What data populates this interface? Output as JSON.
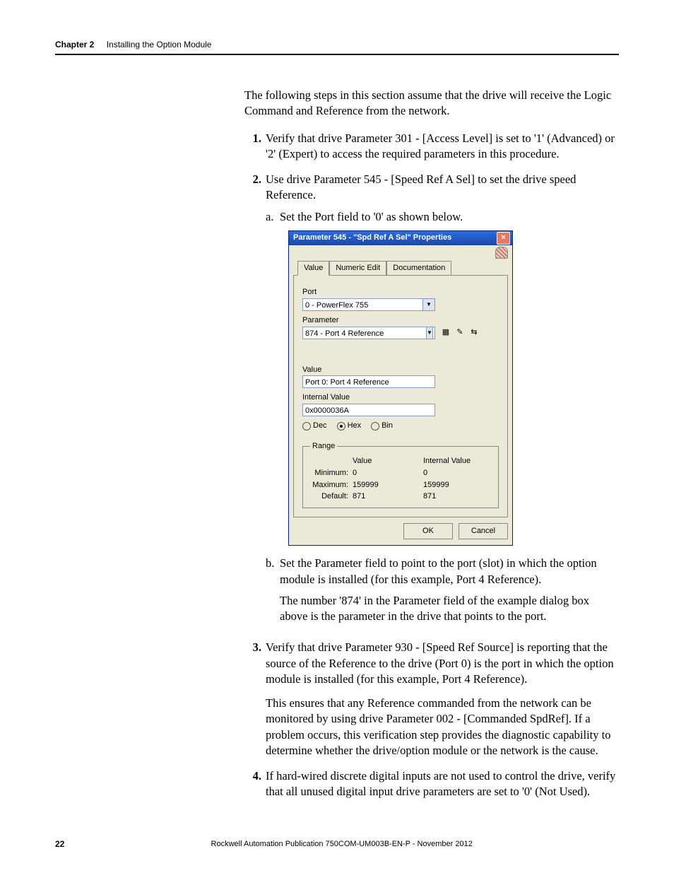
{
  "header": {
    "chapter": "Chapter 2",
    "title": "Installing the Option Module"
  },
  "intro": "The following steps in this section assume that the drive will receive the Logic Command and Reference from the network.",
  "steps": {
    "s1": {
      "num": "1.",
      "text": "Verify that drive Parameter 301 - [Access Level] is set to '1' (Advanced) or '2' (Expert) to access the required parameters in this procedure."
    },
    "s2": {
      "num": "2.",
      "text": "Use drive Parameter 545 - [Speed Ref A Sel] to set the drive speed Reference.",
      "a": {
        "mark": "a.",
        "text": "Set the Port field to '0' as shown below."
      },
      "b": {
        "mark": "b.",
        "text": "Set the Parameter field to point to the port (slot) in which the option module is installed (for this example, Port 4 Reference).",
        "para": "The number '874' in the Parameter field of the example dialog box above is the parameter in the drive that points to the port."
      }
    },
    "s3": {
      "num": "3.",
      "text": "Verify that drive Parameter 930 - [Speed Ref Source] is reporting that the source of the Reference to the drive (Port 0) is the port in which the option module is installed (for this example, Port 4 Reference).",
      "para": "This ensures that any Reference commanded from the network can be monitored by using drive Parameter 002 - [Commanded SpdRef]. If a problem occurs, this verification step provides the diagnostic capability to determine whether the drive/option module or the network is the cause."
    },
    "s4": {
      "num": "4.",
      "text": "If hard-wired discrete digital inputs are not used to control the drive, verify that all unused digital input drive parameters are set to '0' (Not Used)."
    }
  },
  "dialog": {
    "title": "Parameter 545 - \"Spd Ref A Sel\" Properties",
    "close": "×",
    "tabs": {
      "value": "Value",
      "numeric": "Numeric Edit",
      "doc": "Documentation"
    },
    "fields": {
      "port_label": "Port",
      "port_value": "0 - PowerFlex 755",
      "param_label": "Parameter",
      "param_value": "874 - Port 4 Reference",
      "value_label": "Value",
      "value_value": "Port 0: Port 4 Reference",
      "internal_label": "Internal Value",
      "internal_value": "0x0000036A",
      "radix": {
        "dec": "Dec",
        "hex": "Hex",
        "bin": "Bin"
      }
    },
    "range": {
      "legend": "Range",
      "hdr_value": "Value",
      "hdr_internal": "Internal Value",
      "min_label": "Minimum:",
      "min_value": "0",
      "min_internal": "0",
      "max_label": "Maximum:",
      "max_value": "159999",
      "max_internal": "159999",
      "def_label": "Default:",
      "def_value": "871",
      "def_internal": "871"
    },
    "buttons": {
      "ok": "OK",
      "cancel": "Cancel"
    }
  },
  "footer": {
    "page": "22",
    "pub": "Rockwell Automation Publication 750COM-UM003B-EN-P - November 2012"
  }
}
